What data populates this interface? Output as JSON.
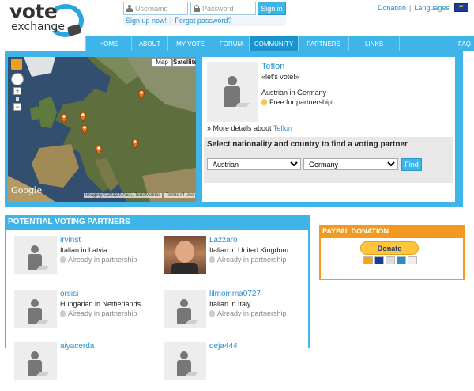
{
  "header": {
    "logo_word1": "vote",
    "logo_word2": "exchange",
    "username_placeholder": "Username",
    "password_placeholder": "Password",
    "signin_label": "Sign in",
    "signup_label": "Sign up now!",
    "forgot_label": "Forgot password?",
    "donation_label": "Donation",
    "languages_label": "Languages"
  },
  "nav": {
    "items": [
      {
        "label": "HOME",
        "width": 58
      },
      {
        "label": "ABOUT",
        "width": 46
      },
      {
        "label": "MY VOTE",
        "width": 57
      },
      {
        "label": "FORUM",
        "width": 46
      },
      {
        "label": "COMMUNITY",
        "width": 62
      },
      {
        "label": "PARTNERS",
        "width": 64
      },
      {
        "label": "LINKS",
        "width": 64
      },
      {
        "label": "FAQ",
        "width": 95
      }
    ],
    "active_index": 4
  },
  "map": {
    "map_label": "Map",
    "satellite_label": "Satellite",
    "google_label": "Google",
    "attribution": "Imagery ©2013 NASA, TerraMetrics",
    "terms_label": "Terms of Use"
  },
  "profile": {
    "name": "Teflon",
    "motto": "«let's vote!»",
    "nationality": "Austrian in Germany",
    "status": "Free for partnership!",
    "more_prefix": "» More details about",
    "more_name": "Teflon"
  },
  "finder": {
    "title": "Select nationality and country to find a voting partner",
    "nationality_value": "Austrian",
    "country_value": "Germany",
    "find_label": "Find"
  },
  "partners": {
    "title": "POTENTIAL VOTING PARTNERS",
    "items": [
      {
        "name": "irvinst",
        "nationality": "Italian in Latvia",
        "status": "Already in partnership",
        "photo": false
      },
      {
        "name": "Lazzaro",
        "nationality": "Italian in United Kingdom",
        "status": "Already in partnership",
        "photo": true
      },
      {
        "name": "orsisi",
        "nationality": "Hungarian in Netherlands",
        "status": "Already in partnership",
        "photo": false
      },
      {
        "name": "lilmomma0727",
        "nationality": "Italian in Italy",
        "status": "Already in partnership",
        "photo": false
      },
      {
        "name": "aiyacerda",
        "nationality": "",
        "status": "",
        "photo": false
      },
      {
        "name": "deja444",
        "nationality": "",
        "status": "",
        "photo": false
      }
    ]
  },
  "paypal": {
    "title": "PAYPAL DONATION",
    "donate_label": "Donate"
  },
  "colors": {
    "accent": "#3eb4e8",
    "paypal": "#f29a1f"
  }
}
